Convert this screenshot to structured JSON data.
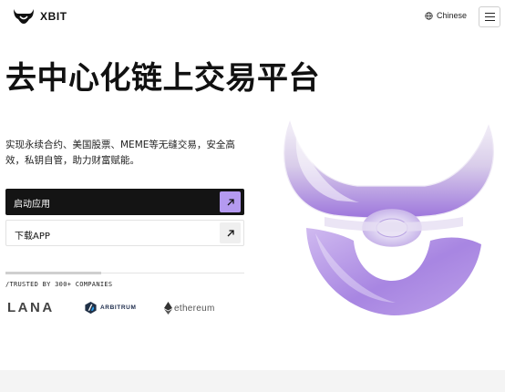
{
  "header": {
    "brand": "XBIT",
    "language_label": "Chinese"
  },
  "hero": {
    "title": "去中心化链上交易平台",
    "subtitle": "实现永续合约、美国股票、MEME等无缝交易，安全高效，私钥自管，助力财富赋能。",
    "primary_button_label": "启动应用",
    "secondary_button_label": "下载APP",
    "carousel_progress": 0.4
  },
  "partners": {
    "heading": "/TRUSTED BY 300+ COMPANIES",
    "logos": [
      "LANA",
      "ARBITRUM",
      "ethereum"
    ]
  },
  "colors": {
    "accent": "#b49af0",
    "primary_button": "#141414",
    "graphic": "#a37fe0"
  },
  "icons": [
    "xbit-logo-icon",
    "globe-icon",
    "menu-icon",
    "arrow-up-right-icon",
    "arbitrum-logo-icon",
    "ethereum-logo-icon"
  ]
}
